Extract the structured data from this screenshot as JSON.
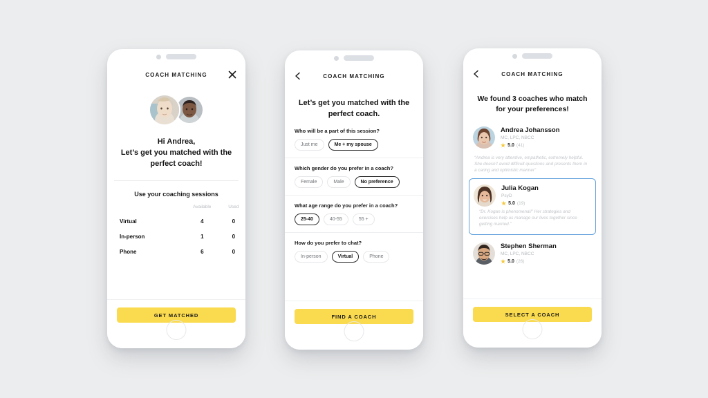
{
  "theme": {
    "page_background": "#ecedee",
    "accent_yellow": "#fada4e",
    "selected_card_border": "#60a0dd",
    "star_color": "#f6c93c",
    "text_dark": "#141414",
    "text_muted": "#b9bcc1"
  },
  "screens": [
    {
      "id": "welcome",
      "header": {
        "title": "COACH MATCHING",
        "close_icon": "close-icon"
      },
      "hero": "Hi Andrea,\nLet’s get you matched with the perfect coach!",
      "hero_line1": "Hi Andrea,",
      "hero_line2": "Let’s get you matched with the",
      "hero_line3": "perfect coach!",
      "sessions": {
        "title": "Use your coaching sessions",
        "columns": [
          "",
          "Available",
          "Used"
        ],
        "rows": [
          {
            "label": "Virtual",
            "available": "4",
            "used": "0"
          },
          {
            "label": "In-person",
            "available": "1",
            "used": "0"
          },
          {
            "label": "Phone",
            "available": "6",
            "used": "0"
          }
        ]
      },
      "cta": "GET MATCHED"
    },
    {
      "id": "preferences",
      "header": {
        "title": "COACH MATCHING",
        "back_icon": "chevron-left-icon"
      },
      "hero_line1": "Let’s get you matched with the",
      "hero_line2": "perfect coach.",
      "questions": [
        {
          "label": "Who will be a part of this session?",
          "options": [
            {
              "text": "Just me",
              "selected": false
            },
            {
              "text": "Me + my spouse",
              "selected": true
            }
          ]
        },
        {
          "label": "Which gender do you prefer in a coach?",
          "options": [
            {
              "text": "Female",
              "selected": false
            },
            {
              "text": "Male",
              "selected": false
            },
            {
              "text": "No preference",
              "selected": true
            }
          ]
        },
        {
          "label": "What age range do you prefer in a coach?",
          "options": [
            {
              "text": "25-40",
              "selected": true
            },
            {
              "text": "40-55",
              "selected": false
            },
            {
              "text": "55 +",
              "selected": false
            }
          ]
        },
        {
          "label": "How do you prefer to chat?",
          "options": [
            {
              "text": "In-person",
              "selected": false
            },
            {
              "text": "Virtual",
              "selected": true
            },
            {
              "text": "Phone",
              "selected": false
            }
          ]
        }
      ],
      "cta": "FIND A COACH"
    },
    {
      "id": "results",
      "header": {
        "title": "COACH MATCHING",
        "back_icon": "chevron-left-icon"
      },
      "hero_line1": "We found 3 coaches who match",
      "hero_line2": "for your preferences!",
      "coaches": [
        {
          "name": "Andrea Johansson",
          "credentials": "MC, LPC, NBCC",
          "rating": "5.0",
          "review_count": "(41)",
          "quote": "“Andrea is very attentive, empathetic, extremely helpful. She doesn’t avoid difficult questions and presents them in a caring and optimistic manner”",
          "selected": false
        },
        {
          "name": "Julia Kogan",
          "credentials": "PsyD",
          "rating": "5.0",
          "review_count": "(19)",
          "quote": "“Dr. Kogan is phenomenal!” Her strategies and exercises help us manage our lives together since getting married.”",
          "selected": true
        },
        {
          "name": "Stephen Sherman",
          "credentials": "MC, LPC, NBCC",
          "rating": "5.0",
          "review_count": "(26)",
          "quote": "",
          "selected": false
        }
      ],
      "cta": "SELECT A COACH"
    }
  ]
}
